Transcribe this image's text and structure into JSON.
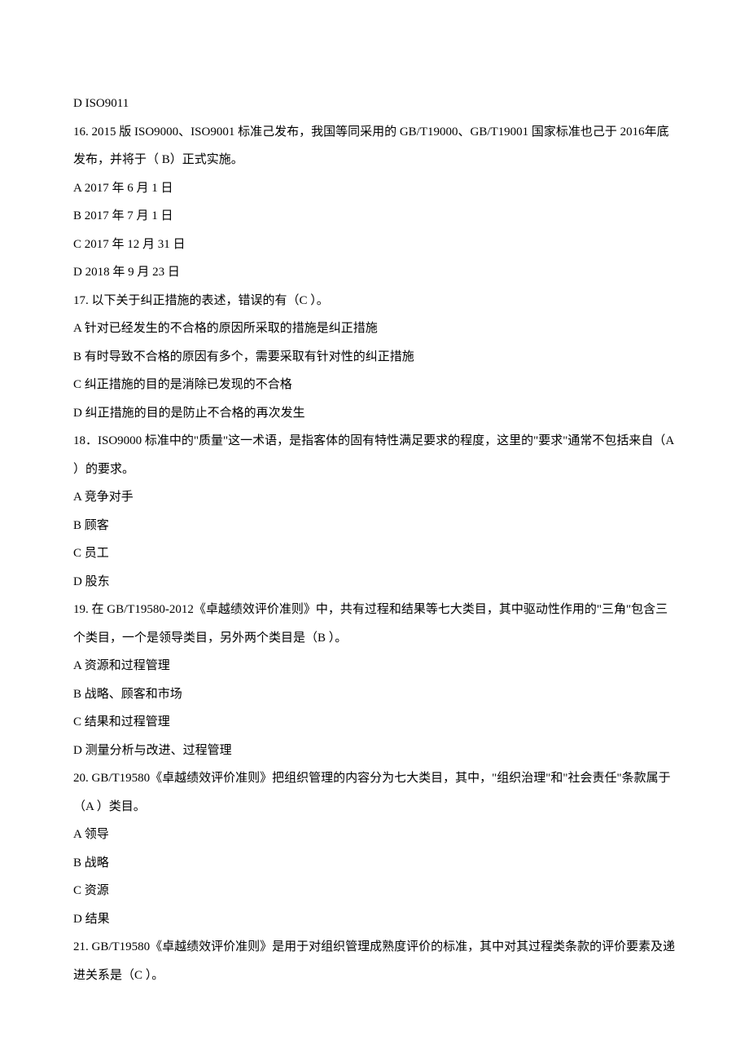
{
  "lines": [
    "D ISO9011",
    "16. 2015 版 ISO9000、ISO9001 标准己发布，我国等同采用的 GB/T19000、GB/T19001 国家标准也己于 2016年底发布，并将于（ B）正式实施。",
    "A 2017 年 6 月 1 日",
    "B 2017 年 7 月 1 日",
    "C 2017 年 12 月 31 日",
    "D 2018 年 9 月 23 日",
    "17. 以下关于纠正措施的表述，错误的有（C ）。",
    "A 针对已经发生的不合格的原因所采取的措施是纠正措施",
    "B 有时导致不合格的原因有多个，需要采取有针对性的纠正措施",
    "C 纠正措施的目的是消除已发现的不合格",
    "D 纠正措施的目的是防止不合格的再次发生",
    "18．ISO9000 标准中的\"质量\"这一术语，是指客体的固有特性满足要求的程度，这里的\"要求\"通常不包括来自（A ）的要求。",
    "A 竞争对手",
    "B 顾客",
    "C 员工",
    "D 股东",
    "19. 在 GB/T19580-2012《卓越绩效评价准则》中，共有过程和结果等七大类目，其中驱动性作用的\"三角\"包含三个类目，一个是领导类目，另外两个类目是（B ）。",
    "A 资源和过程管理",
    "B 战略、顾客和市场",
    "C 结果和过程管理",
    "D 测量分析与改进、过程管理",
    "20. GB/T19580《卓越绩效评价准则》把组织管理的内容分为七大类目，其中，\"组织治理\"和\"社会责任\"条款属于（A ）类目。",
    "A 领导",
    "B 战略",
    "C 资源",
    "D 结果",
    "21. GB/T19580《卓越绩效评价准则》是用于对组织管理成熟度评价的标准，其中对其过程类条款的评价要素及递进关系是（C ）。"
  ]
}
